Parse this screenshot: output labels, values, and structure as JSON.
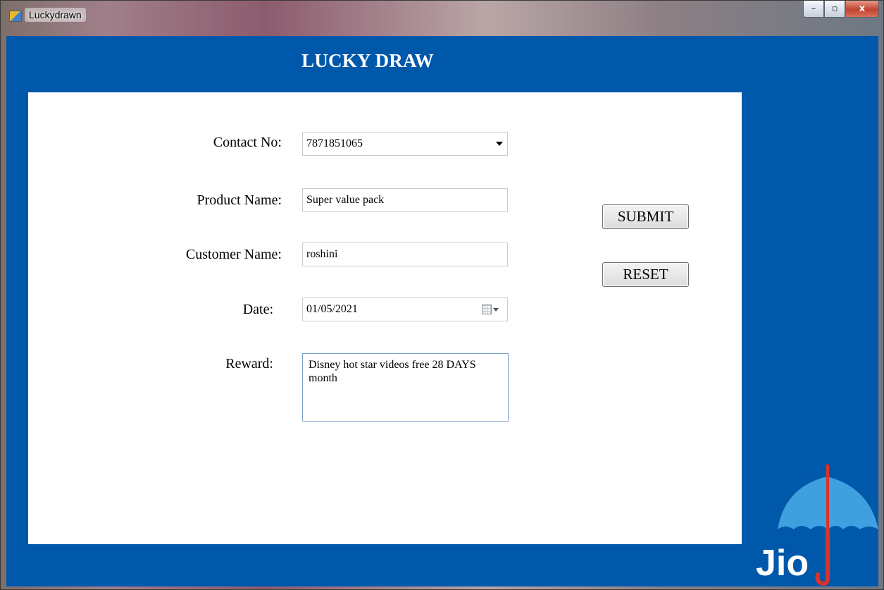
{
  "window": {
    "title": "Luckydrawn",
    "controls": {
      "minimize": "–",
      "maximize": "▫",
      "close": "x"
    }
  },
  "form": {
    "heading": "LUCKY DRAW",
    "fields": {
      "contact": {
        "label": "Contact No:",
        "value": "7871851065"
      },
      "product": {
        "label": "Product Name:",
        "value": "Super value pack"
      },
      "customer": {
        "label": "Customer Name:",
        "value": "roshini"
      },
      "date": {
        "label": "Date:",
        "value": "01/05/2021"
      },
      "reward": {
        "label": "Reward:",
        "value": "Disney hot star videos free 28 DAYS month"
      }
    },
    "buttons": {
      "submit": "SUBMIT",
      "reset": "RESET"
    }
  },
  "branding": {
    "logo_text": "Jio",
    "logo_icon": "umbrella-icon",
    "colors": {
      "background": "#0058aa",
      "umbrella": "#3fa0e0",
      "handle": "#d9342b"
    }
  }
}
